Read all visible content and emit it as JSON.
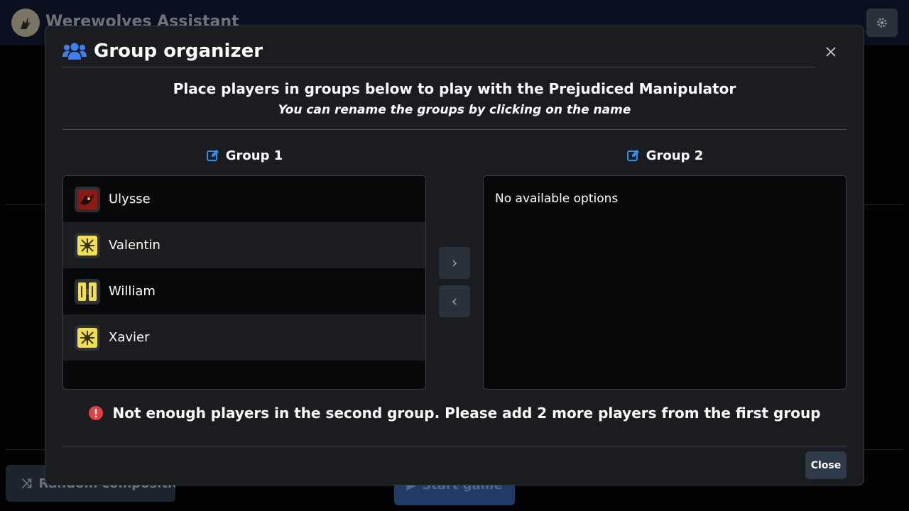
{
  "app": {
    "title": "Werewolves Assistant",
    "random_button_label": "Random composition",
    "start_button_label": "Start game"
  },
  "modal": {
    "title": "Group organizer",
    "intro_title": "Place players in groups below to play with the Prejudiced Manipulator",
    "intro_subtitle": "You can rename the groups by clicking on the name",
    "group1": {
      "name": "Group 1",
      "players": [
        {
          "name": "Ulysse",
          "avatar": "red-wolf-role-icon"
        },
        {
          "name": "Valentin",
          "avatar": "yellow-villager-role-icon"
        },
        {
          "name": "William",
          "avatar": "yellow-twin-role-icon"
        },
        {
          "name": "Xavier",
          "avatar": "yellow-villager-role-icon"
        }
      ]
    },
    "group2": {
      "name": "Group 2",
      "empty_message": "No available options"
    },
    "warning": "Not enough players in the second group. Please add 2 more players from the first group",
    "close_label": "Close"
  },
  "colors": {
    "accent_blue": "#2e8ee8",
    "warning_red": "#e53e3e",
    "icon_title_blue": "#3b82f6"
  }
}
